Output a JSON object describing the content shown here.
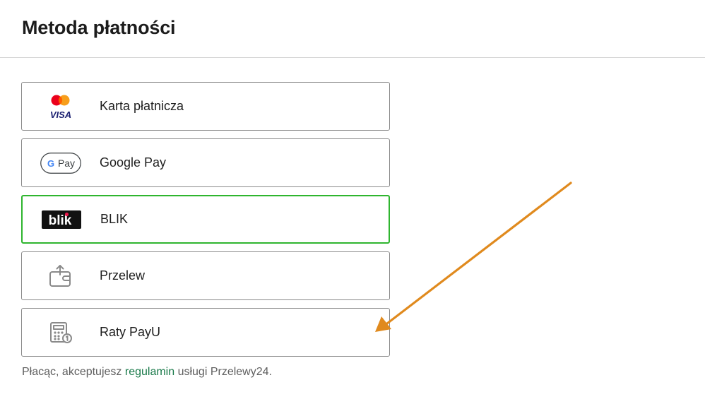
{
  "header": {
    "title": "Metoda płatności"
  },
  "methods": [
    {
      "label": "Karta płatnicza",
      "icon": "card-visa-mastercard-icon",
      "selected": false
    },
    {
      "label": "Google Pay",
      "icon": "google-pay-icon",
      "selected": false
    },
    {
      "label": "BLIK",
      "icon": "blik-icon",
      "selected": true
    },
    {
      "label": "Przelew",
      "icon": "wallet-transfer-icon",
      "selected": false
    },
    {
      "label": "Raty PayU",
      "icon": "calculator-installments-icon",
      "selected": false
    }
  ],
  "logos": {
    "visa": "VISA",
    "gpay": "Pay",
    "gpay_g": "G",
    "blik": "blik"
  },
  "footer": {
    "prefix": "Płacąc, akceptujesz ",
    "link": "regulamin",
    "suffix": " usługi Przelewy24."
  },
  "colors": {
    "selected_border": "#2fb52f",
    "link": "#1a7a4a",
    "annotation_arrow": "#e08a1e"
  }
}
